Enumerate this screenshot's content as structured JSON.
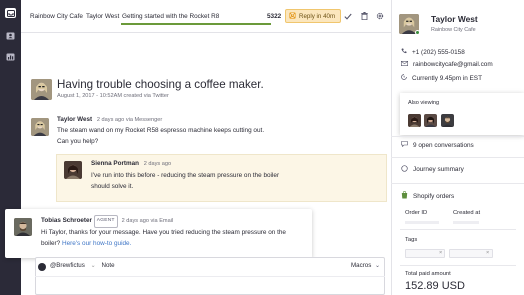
{
  "tabs": [
    {
      "label": "Rainbow City Cafe"
    },
    {
      "label": "Taylor West"
    },
    {
      "label": "Getting started with the Rocket R8"
    }
  ],
  "ticket_number": "5322",
  "reply_badge": "Reply in 40m",
  "conversation": {
    "subject": "Having trouble choosing a coffee maker.",
    "subject_meta": "August 1, 2017 - 10:52AM created via Twitter",
    "messages": [
      {
        "author": "Taylor West",
        "meta": "2 days ago via Messenger",
        "lines": [
          "The steam wand on my Rocket R58 espresso machine keeps cutting out.",
          "Can you help?"
        ]
      }
    ],
    "note": {
      "author": "Sienna Portman",
      "meta": "2 days ago",
      "lines": [
        "I've run into this before - reducing the steam pressure on the boiler",
        "should solve it."
      ]
    },
    "agent_reply": {
      "author": "Tobias Schroeter",
      "tag": "AGENT",
      "meta": "2 days ago via Email",
      "line1": "Hi Taylor, thanks for your message. Have you tried reducing the steam pressure on the",
      "line2_prefix": "boiler?",
      "line2_link": "Here's our how-to guide."
    }
  },
  "composer": {
    "channel": "@Brewfictus",
    "note_label": "Note",
    "macros_label": "Macros"
  },
  "customer": {
    "name": "Taylor West",
    "company": "Rainbow City Cafe",
    "phone": "+1 (202) 555-0158",
    "email": "rainbowcitycafe@gmail.com",
    "local_time": "Currently 9.45pm in EST"
  },
  "also_viewing": {
    "label": "Also viewing"
  },
  "sections": {
    "open_conversations": "9 open conversations",
    "journey": "Journey summary",
    "shopify": "Shopify orders"
  },
  "order": {
    "order_id_label": "Order ID",
    "created_label": "Created at",
    "tags_label": "Tags",
    "total_label": "Total paid amount",
    "total_value": "152.89 USD"
  },
  "colors": {
    "rail": "#2b2a38",
    "accent_green": "#6b9a3a",
    "reply_badge_bg": "#fbe6bd",
    "note_bg": "#fcf6e6",
    "link": "#3f76c6",
    "shopify_green": "#5e8e3e"
  },
  "icons": [
    "inbox-icon",
    "contacts-icon",
    "reports-icon",
    "clock-icon",
    "check-icon",
    "trash-icon",
    "gear-icon",
    "phone-icon",
    "email-icon",
    "time-icon",
    "chat-bubble-icon",
    "journey-icon",
    "shopify-bag-icon"
  ]
}
